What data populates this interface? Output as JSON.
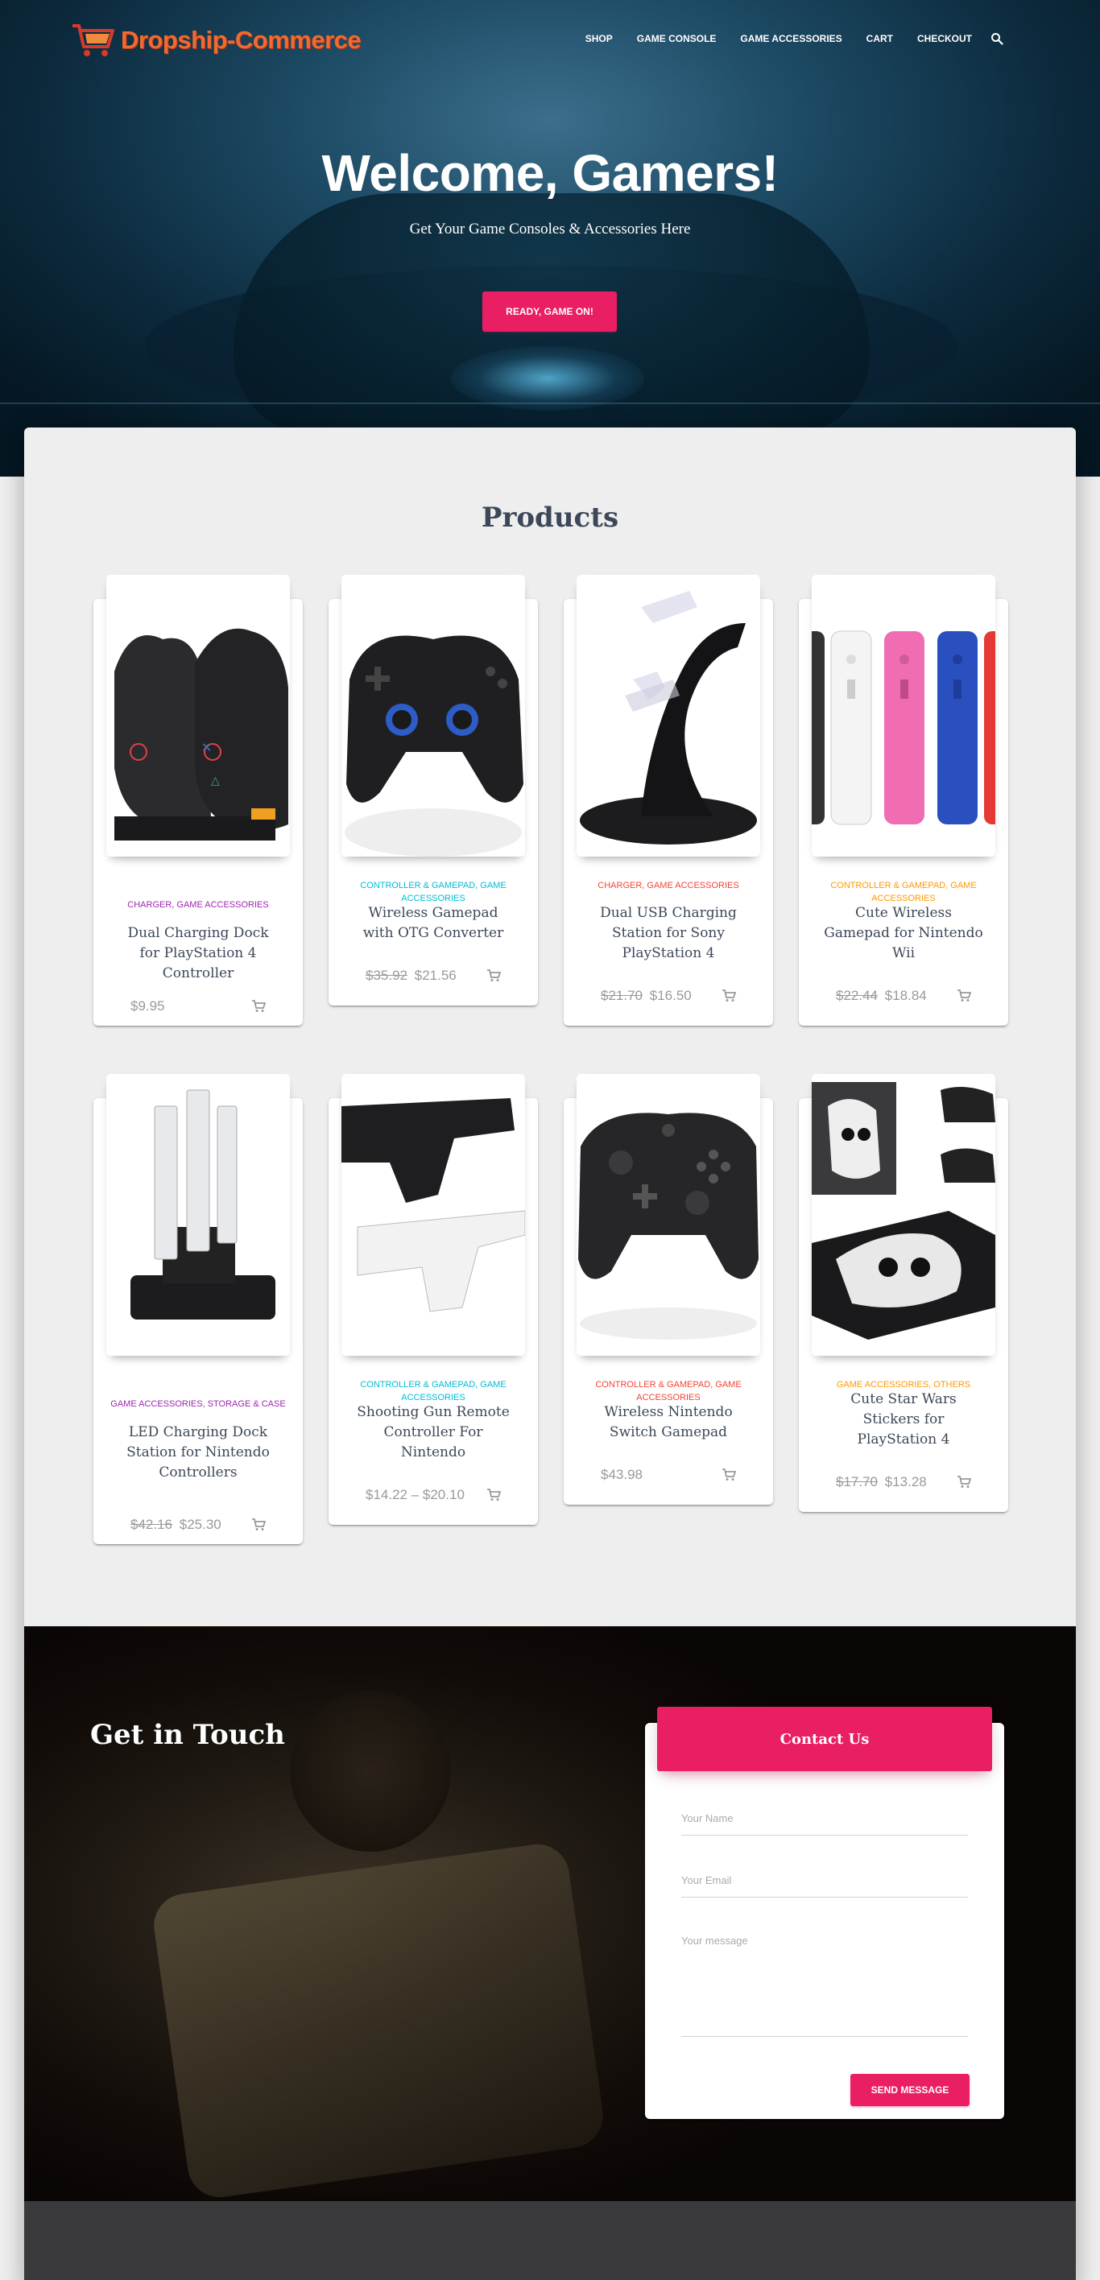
{
  "site": {
    "brand": "Dropship-Commerce",
    "nav": [
      "SHOP",
      "GAME CONSOLE",
      "GAME ACCESSORIES",
      "CART",
      "CHECKOUT"
    ]
  },
  "hero": {
    "title": "Welcome, Gamers!",
    "subtitle": "Get Your Game Consoles & Accessories Here",
    "button": "READY, GAME ON!"
  },
  "products": {
    "title": "Products",
    "items": [
      {
        "category": "CHARGER, GAME ACCESSORIES",
        "category_color": "#9c27b0",
        "name": "Dual Charging Dock for PlayStation 4 Controller",
        "price_old": "",
        "price": "$9.95"
      },
      {
        "category": "CONTROLLER & GAMEPAD, GAME ACCESSORIES",
        "category_color": "#00bcd4",
        "name": "Wireless Gamepad with OTG Converter",
        "price_old": "$35.92",
        "price": "$21.56"
      },
      {
        "category": "CHARGER, GAME ACCESSORIES",
        "category_color": "#f44336",
        "name": "Dual USB Charging Station for Sony PlayStation 4",
        "price_old": "$21.70",
        "price": "$16.50"
      },
      {
        "category": "CONTROLLER & GAMEPAD, GAME ACCESSORIES",
        "category_color": "#ff9800",
        "name": "Cute Wireless Gamepad for Nintendo Wii",
        "price_old": "$22.44",
        "price": "$18.84"
      },
      {
        "category": "GAME ACCESSORIES, STORAGE & CASE",
        "category_color": "#9c27b0",
        "name": "LED Charging Dock Station for Nintendo Controllers",
        "price_old": "$42.16",
        "price": "$25.30"
      },
      {
        "category": "CONTROLLER & GAMEPAD, GAME ACCESSORIES",
        "category_color": "#00bcd4",
        "name": "Shooting Gun Remote Controller For Nintendo",
        "price_old": "",
        "price": "$14.22 – $20.10"
      },
      {
        "category": "CONTROLLER & GAMEPAD, GAME ACCESSORIES",
        "category_color": "#f44336",
        "name": "Wireless Nintendo Switch Gamepad",
        "price_old": "",
        "price": "$43.98"
      },
      {
        "category": "GAME ACCESSORIES, OTHERS",
        "category_color": "#ff9800",
        "name": "Cute Star Wars Stickers for PlayStation 4",
        "price_old": "$17.70",
        "price": "$13.28"
      }
    ]
  },
  "contact": {
    "title": "Get in Touch",
    "card_title": "Contact Us",
    "name_placeholder": "Your Name",
    "email_placeholder": "Your Email",
    "message_placeholder": "Your message",
    "send_label": "SEND MESSAGE"
  },
  "colors": {
    "accent": "#e91e63",
    "brand": "#ef6b2f"
  }
}
